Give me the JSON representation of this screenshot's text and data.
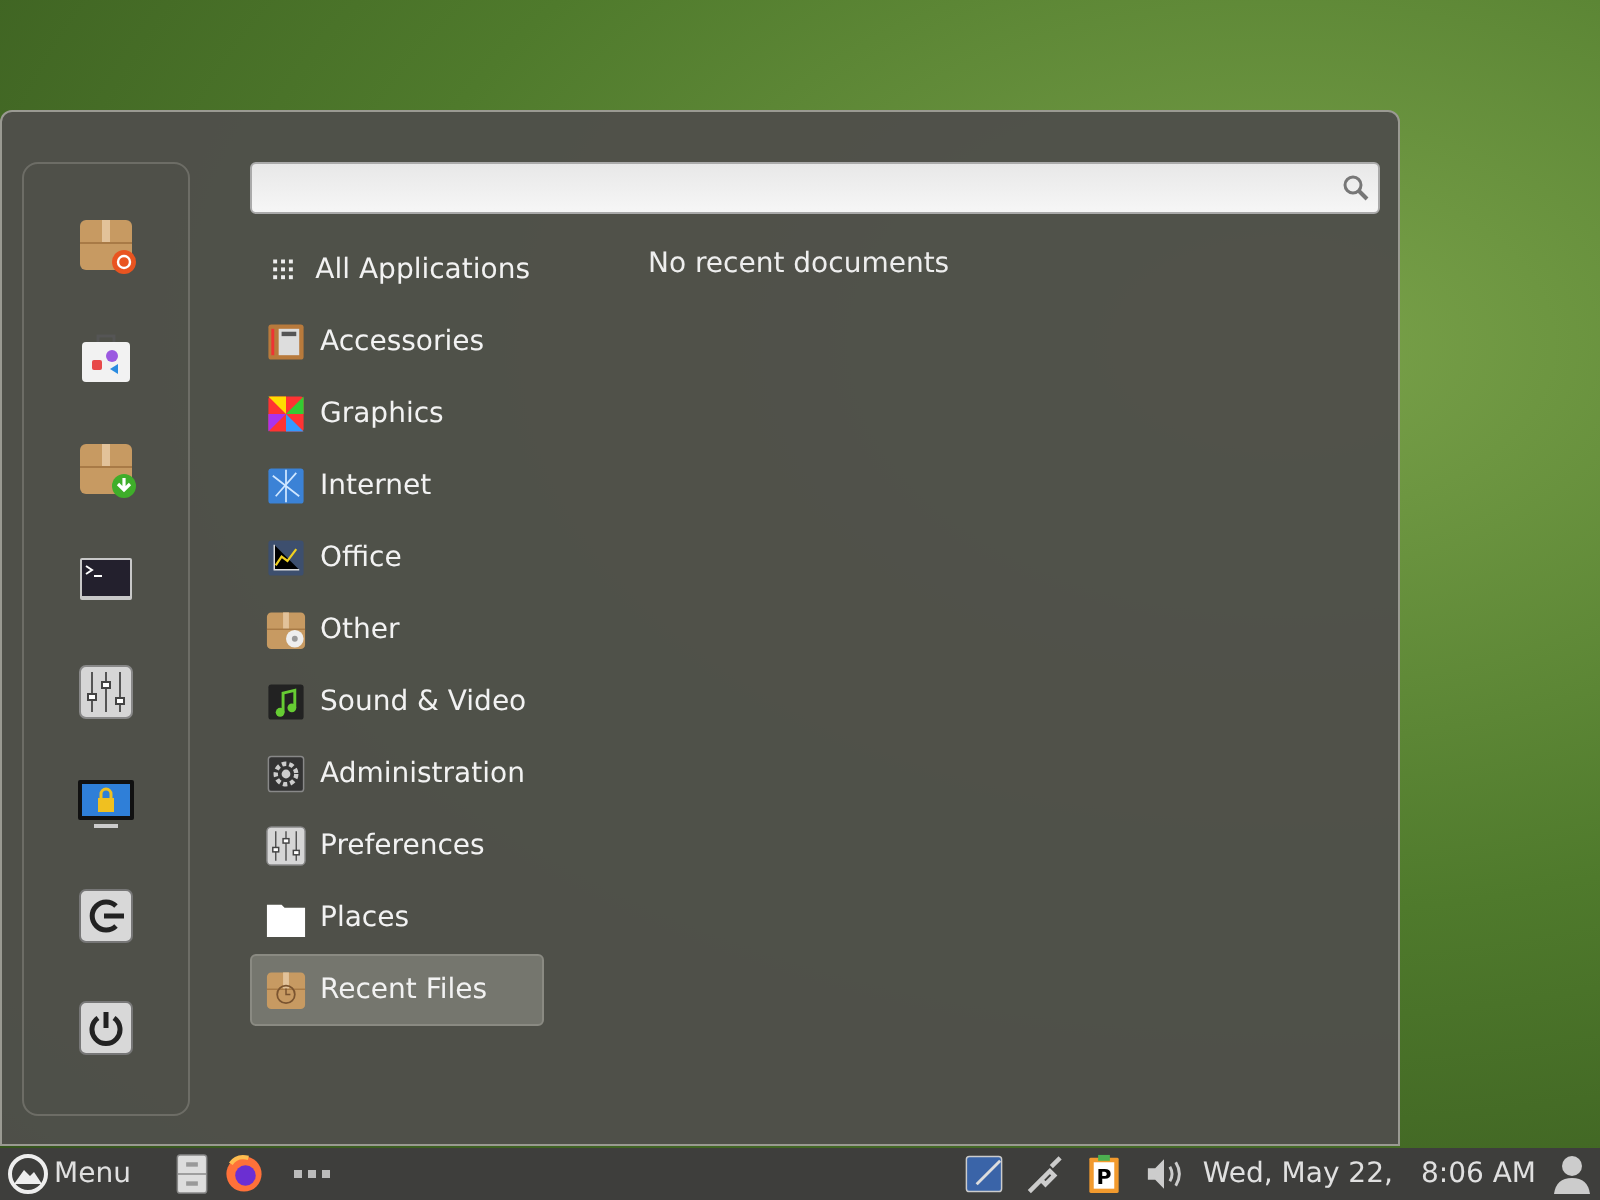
{
  "menu": {
    "favorites": [
      {
        "kind": "package-update"
      },
      {
        "kind": "store"
      },
      {
        "kind": "package-install"
      },
      {
        "kind": "terminal"
      },
      {
        "kind": "settings"
      },
      {
        "kind": "lock"
      },
      {
        "kind": "logout"
      },
      {
        "kind": "power"
      }
    ],
    "categories": [
      {
        "label": "All Applications",
        "kind": "grid",
        "selected": false
      },
      {
        "label": "Accessories",
        "kind": "accessories",
        "selected": false
      },
      {
        "label": "Graphics",
        "kind": "graphics",
        "selected": false
      },
      {
        "label": "Internet",
        "kind": "internet",
        "selected": false
      },
      {
        "label": "Office",
        "kind": "office",
        "selected": false
      },
      {
        "label": "Other",
        "kind": "other",
        "selected": false
      },
      {
        "label": "Sound & Video",
        "kind": "media",
        "selected": false
      },
      {
        "label": "Administration",
        "kind": "admin",
        "selected": false
      },
      {
        "label": "Preferences",
        "kind": "settings",
        "selected": false
      },
      {
        "label": "Places",
        "kind": "folder",
        "selected": false
      },
      {
        "label": "Recent Files",
        "kind": "recent",
        "selected": true
      }
    ],
    "message": "No recent documents"
  },
  "taskbar": {
    "menu_label": "Menu",
    "launchers": [
      {
        "kind": "files"
      },
      {
        "kind": "browser"
      }
    ],
    "tray": [
      {
        "kind": "display"
      },
      {
        "kind": "network"
      },
      {
        "kind": "clipboard",
        "letter": "P"
      },
      {
        "kind": "volume"
      }
    ],
    "date": "Wed, May 22,",
    "time": "8:06 AM"
  }
}
